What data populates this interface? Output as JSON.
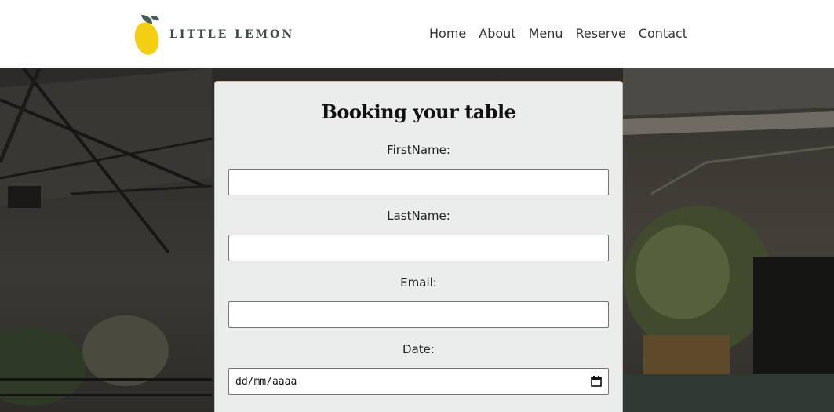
{
  "header": {
    "brand": "LITTLE LEMON",
    "nav": [
      "Home",
      "About",
      "Menu",
      "Reserve",
      "Contact"
    ]
  },
  "form": {
    "title": "Booking your table",
    "fields": [
      {
        "label": "FirstName:",
        "value": ""
      },
      {
        "label": "LastName:",
        "value": ""
      },
      {
        "label": "Email:",
        "value": ""
      },
      {
        "label": "Date:",
        "placeholder": "dd/mm/aaaa"
      }
    ]
  },
  "colors": {
    "logo_yellow": "#f4ce14",
    "logo_leaf": "#495e57",
    "card_bg": "#ebecec",
    "card_border": "#d8b898"
  }
}
